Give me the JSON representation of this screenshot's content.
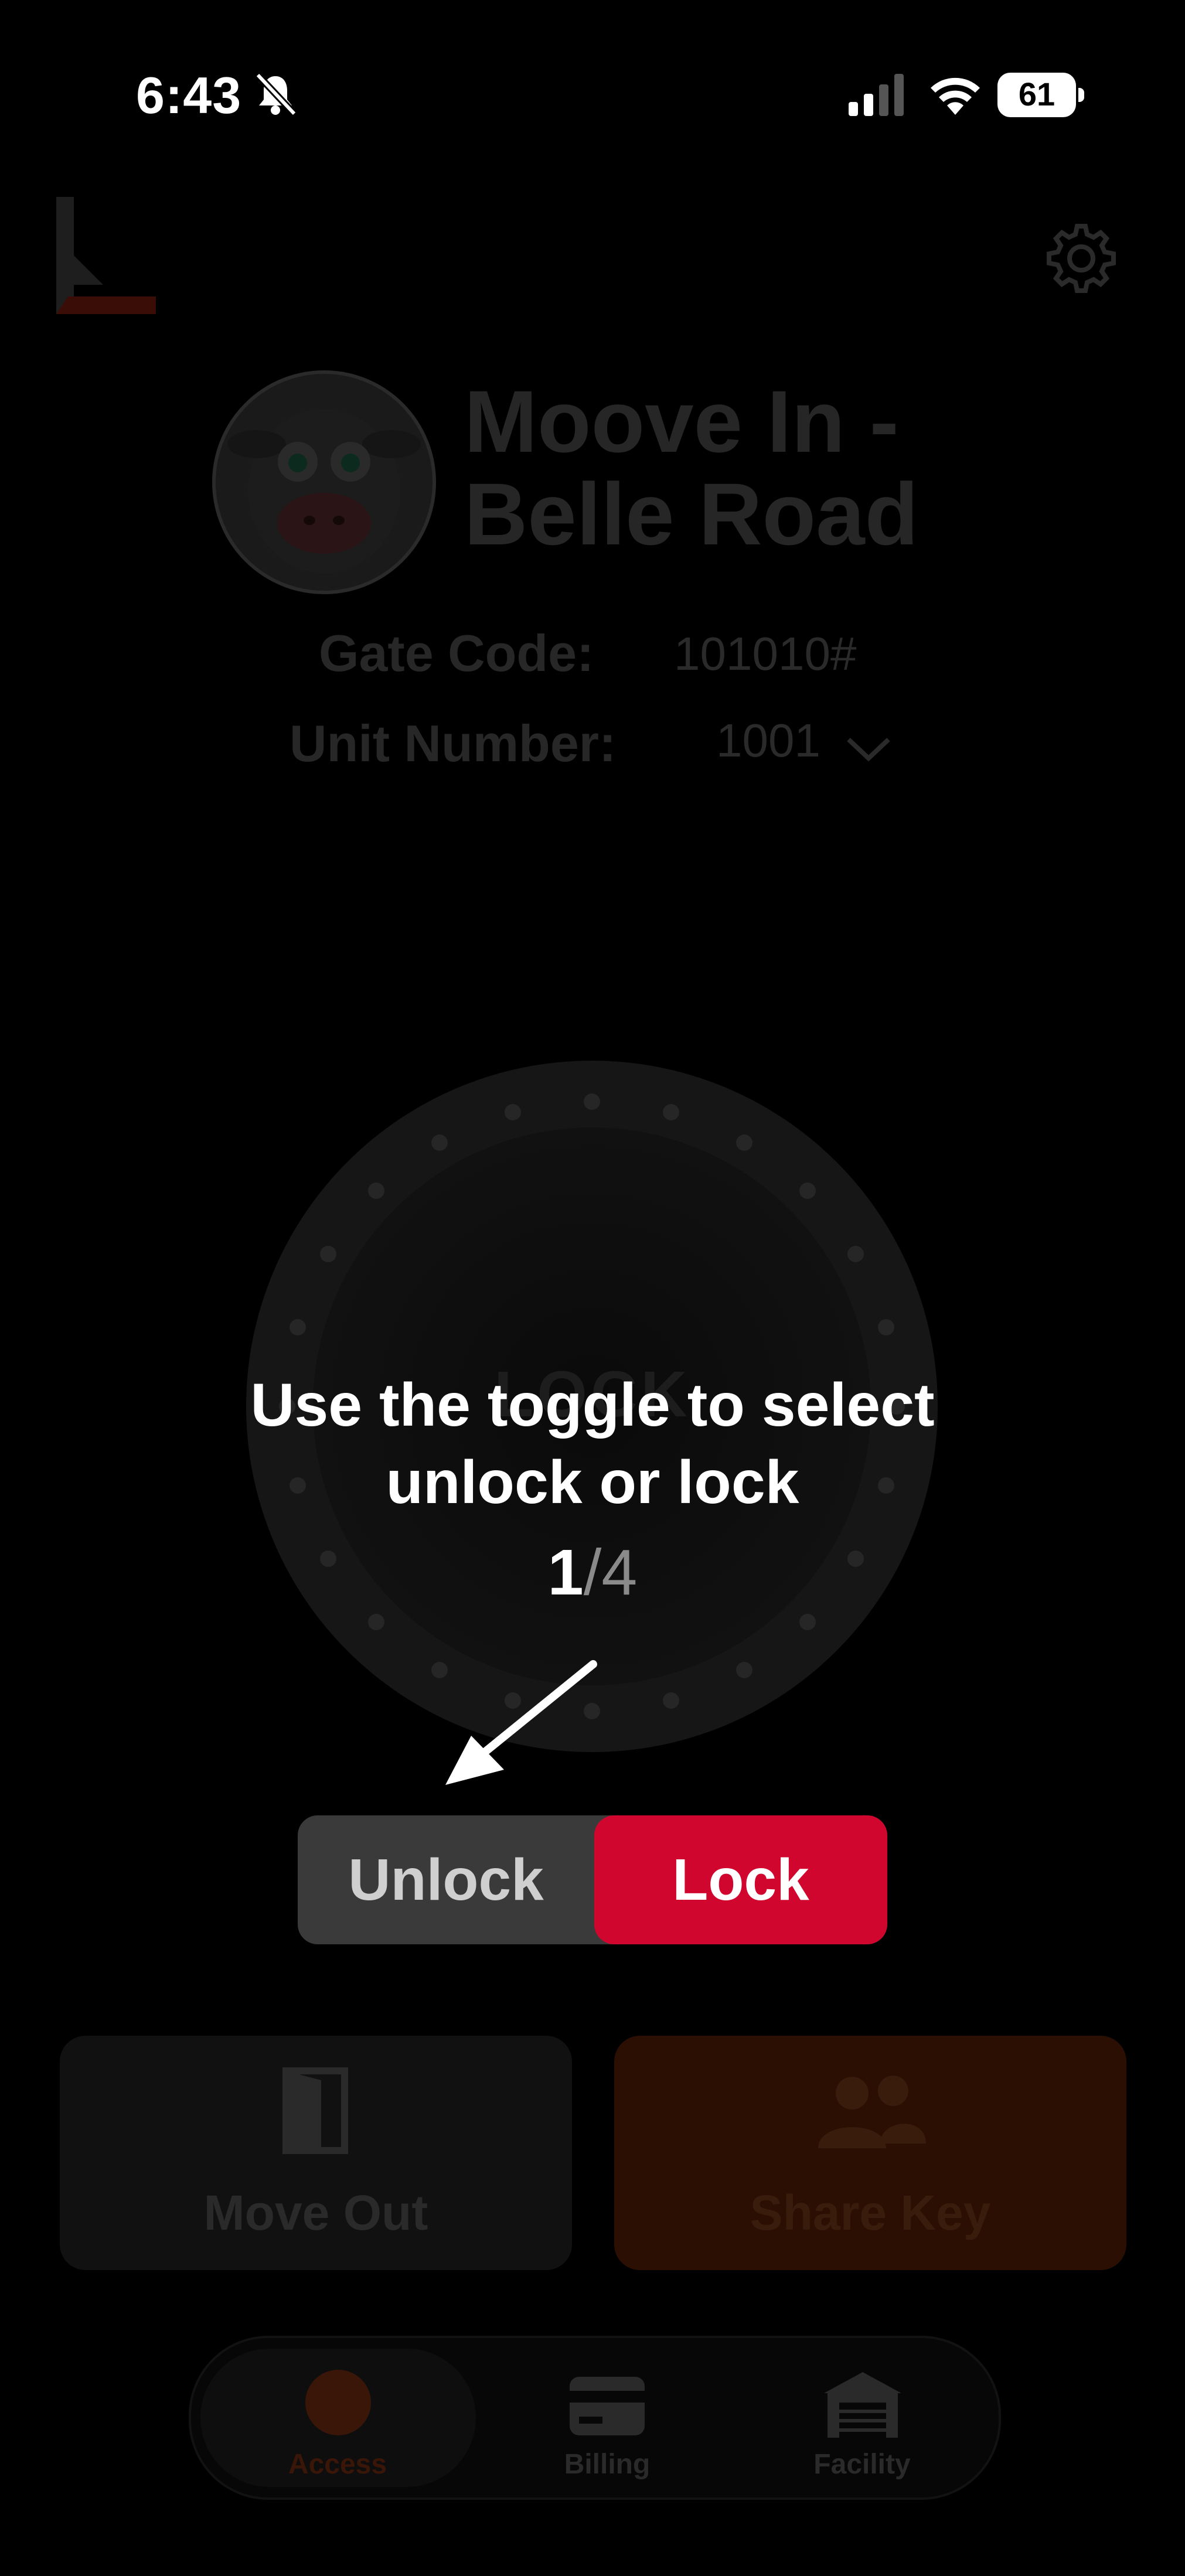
{
  "status_bar": {
    "time": "6:43",
    "battery": "61"
  },
  "facility": {
    "name_line1": "Moove In -",
    "name_line2": "Belle Road",
    "gate_code_label": "Gate Code:",
    "gate_code_value": "101010#",
    "unit_number_label": "Unit Number:",
    "unit_number_value": "1001"
  },
  "dial": {
    "label": "LOCK"
  },
  "tooltip": {
    "line1": "Use the toggle to select",
    "line2": "unlock or lock",
    "step_current": "1",
    "step_total": "/4"
  },
  "toggle": {
    "unlock_label": "Unlock",
    "lock_label": "Lock",
    "selected": "Lock"
  },
  "actions": {
    "move_out_label": "Move Out",
    "share_key_label": "Share Key"
  },
  "tabs": [
    {
      "label": "Access",
      "icon": "access-icon",
      "active": true
    },
    {
      "label": "Billing",
      "icon": "billing-icon",
      "active": false
    },
    {
      "label": "Facility",
      "icon": "facility-icon",
      "active": false
    }
  ],
  "colors": {
    "accent_red": "#d1062f",
    "share_key_orange": "#e0501a",
    "overlay": "rgba(0,0,0,0.85)"
  }
}
